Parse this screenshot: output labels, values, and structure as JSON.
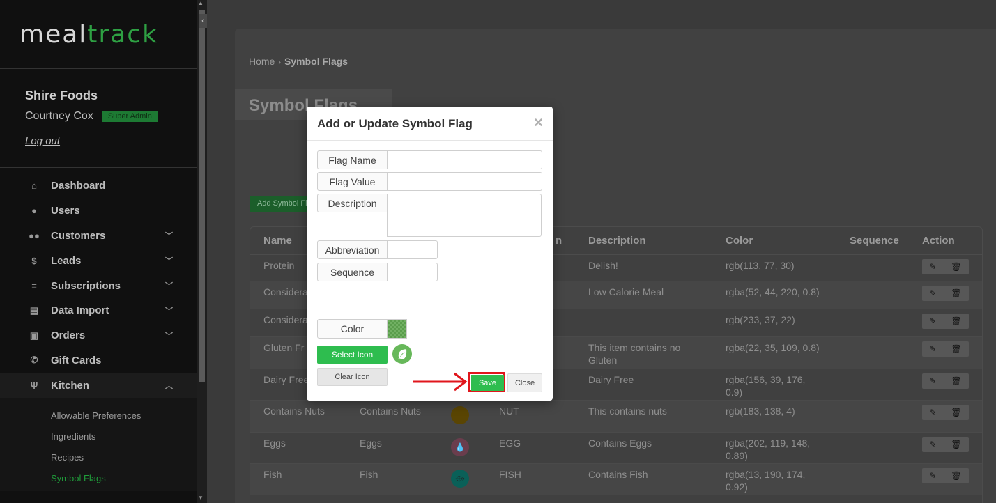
{
  "app": {
    "logo_part1": "meal",
    "logo_part2": "track",
    "org_name": "Shire Foods",
    "user_name": "Courtney Cox",
    "role_badge": "Super Admin",
    "logout_label": "Log out"
  },
  "sidebar": {
    "items": [
      {
        "label": "Dashboard",
        "icon": "home-icon",
        "glyph": "⌂",
        "has_chevron": false
      },
      {
        "label": "Users",
        "icon": "user-icon",
        "glyph": "●",
        "has_chevron": false
      },
      {
        "label": "Customers",
        "icon": "users-icon",
        "glyph": "●●",
        "has_chevron": true
      },
      {
        "label": "Leads",
        "icon": "dollar-icon",
        "glyph": "$",
        "has_chevron": true
      },
      {
        "label": "Subscriptions",
        "icon": "layers-icon",
        "glyph": "≡",
        "has_chevron": true
      },
      {
        "label": "Data Import",
        "icon": "file-icon",
        "glyph": "▤",
        "has_chevron": true
      },
      {
        "label": "Orders",
        "icon": "bag-icon",
        "glyph": "▣",
        "has_chevron": true
      },
      {
        "label": "Gift Cards",
        "icon": "phone-icon",
        "glyph": "✆",
        "has_chevron": false
      },
      {
        "label": "Kitchen",
        "icon": "utensils-icon",
        "glyph": "Ψ",
        "has_chevron": true
      }
    ],
    "kitchen_sub": [
      "Allowable Preferences",
      "Ingredients",
      "Recipes",
      "Symbol Flags"
    ]
  },
  "breadcrumb": {
    "home": "Home",
    "current": "Symbol Flags"
  },
  "page": {
    "title": "Symbol Flags",
    "add_button": "Add Symbol Flag"
  },
  "table": {
    "headers": {
      "name": "Name",
      "abbr_partial": "n",
      "description": "Description",
      "color": "Color",
      "sequence": "Sequence",
      "action": "Action"
    },
    "rows": [
      {
        "name": "Protein",
        "value": "",
        "abbr": "",
        "description": "Delish!",
        "color": "rgb(113, 77, 30)",
        "dot": "",
        "glyph": ""
      },
      {
        "name": "Considera",
        "value": "",
        "abbr": "",
        "description": "Low Calorie Meal",
        "color": "rgba(52, 44, 220, 0.8)",
        "dot": "",
        "glyph": ""
      },
      {
        "name": "Considera",
        "value": "",
        "abbr": "",
        "description": "",
        "color": "rgb(233, 37, 22)",
        "dot": "",
        "glyph": ""
      },
      {
        "name": "Gluten Fr",
        "value": "",
        "abbr": "",
        "description": "This item contains no Gluten",
        "color": "rgba(22, 35, 109, 0.8)",
        "dot": "",
        "glyph": ""
      },
      {
        "name": "Dairy Free",
        "value": "",
        "abbr": "",
        "description": "Dairy Free",
        "color": "rgba(156, 39, 176, 0.9)",
        "dot": "",
        "glyph": ""
      },
      {
        "name": "Contains Nuts",
        "value": "Contains Nuts",
        "abbr": "NUT",
        "description": "This contains nuts",
        "color": "rgb(183, 138, 4)",
        "dot": "#5a4503",
        "glyph": ""
      },
      {
        "name": "Eggs",
        "value": "Eggs",
        "abbr": "EGG",
        "description": "Contains Eggs",
        "color": "rgba(202, 119, 148, 0.89)",
        "dot": "#6a3d4d",
        "glyph": "💧"
      },
      {
        "name": "Fish",
        "value": "Fish",
        "abbr": "FISH",
        "description": "Contains Fish",
        "color": "rgba(13, 190, 174, 0.92)",
        "dot": "#0a6058",
        "glyph": "⟴"
      }
    ]
  },
  "modal": {
    "title": "Add or Update Symbol Flag",
    "flag_name_label": "Flag Name",
    "flag_name_value": "",
    "flag_value_label": "Flag Value",
    "flag_value_value": "",
    "description_label": "Description",
    "description_value": "",
    "abbreviation_label": "Abbreviation",
    "abbreviation_value": "",
    "sequence_label": "Sequence",
    "sequence_value": "",
    "color_label": "Color",
    "color_value": "#71b063",
    "select_icon_label": "Select Icon",
    "clear_icon_label": "Clear Icon",
    "save_label": "Save",
    "close_label": "Close"
  },
  "colors": {
    "accent": "#2ebd4f",
    "highlight": "#e0161c"
  }
}
